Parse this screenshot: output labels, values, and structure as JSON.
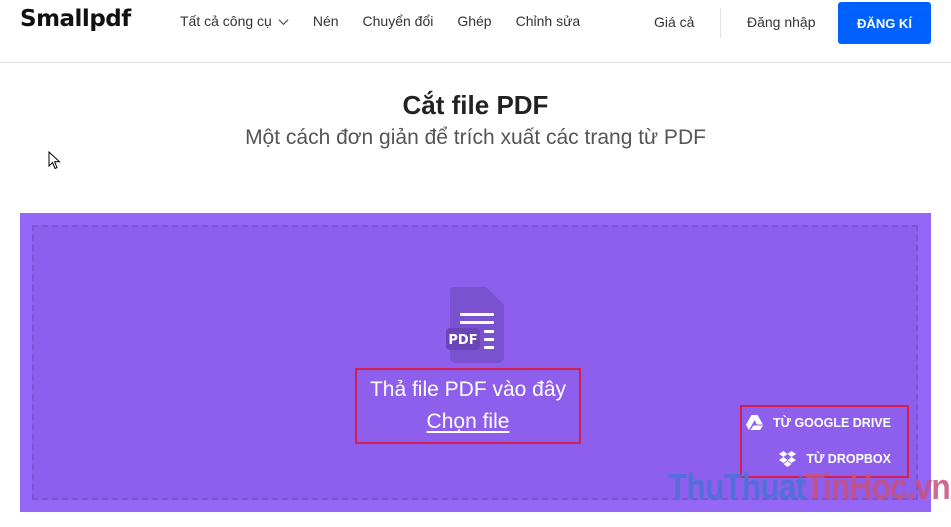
{
  "header": {
    "logo": "Smallpdf",
    "nav": [
      {
        "label": "Tất cả công cụ",
        "has_dropdown": true
      },
      {
        "label": "Nén"
      },
      {
        "label": "Chuyển đổi"
      },
      {
        "label": "Ghép"
      },
      {
        "label": "Chỉnh sửa"
      }
    ],
    "pricing": "Giá cả",
    "login": "Đăng nhập",
    "signup": "ĐĂNG KÍ"
  },
  "page": {
    "title": "Cắt file PDF",
    "subtitle": "Một cách đơn giản để trích xuất các trang từ PDF"
  },
  "dropzone": {
    "icon_label": "PDF",
    "drop_text": "Thả file PDF vào đây",
    "choose_file": "Chọn file",
    "google_drive": "TỪ GOOGLE DRIVE",
    "dropbox": "TỪ DROPBOX"
  },
  "watermark": {
    "part1": "ThuThuat",
    "part2": "TinHoc.vn"
  },
  "colors": {
    "accent_blue": "#0061fe",
    "dropzone_purple": "#9467f7",
    "highlight_red": "#d4204f"
  }
}
